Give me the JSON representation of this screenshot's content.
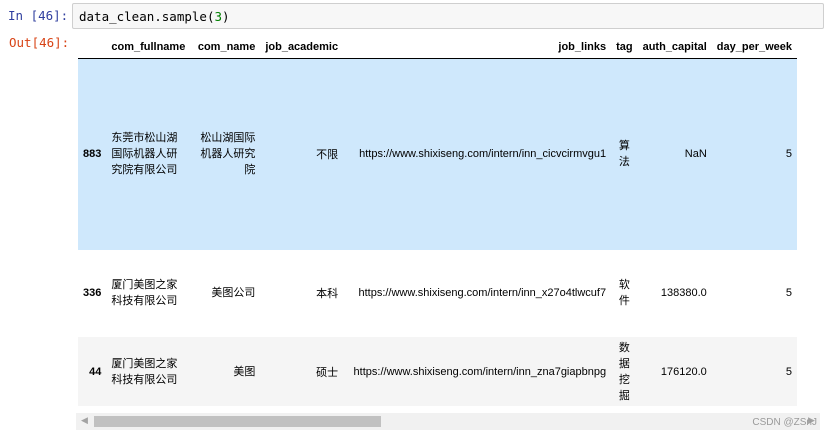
{
  "input_prompt": "In  [46]:",
  "output_prompt": "Out[46]:",
  "code": {
    "object": "data_clean.sample",
    "open_paren": "(",
    "arg": "3",
    "close_paren": ")"
  },
  "table": {
    "columns": [
      "",
      "com_fullname",
      "com_name",
      "job_academic",
      "job_links",
      "tag",
      "auth_capital",
      "day_per_week"
    ],
    "rows": [
      {
        "index": "883",
        "com_fullname": "东莞市松山湖国际机器人研究院有限公司",
        "com_name": "松山湖国际机器人研究院",
        "job_academic": "不限",
        "job_links": "https://www.shixiseng.com/intern/inn_cicvcirmvgu1",
        "tag": "算法",
        "auth_capital": "NaN",
        "day_per_week": "5"
      },
      {
        "index": "336",
        "com_fullname": "厦门美图之家科技有限公司",
        "com_name": "美图公司",
        "job_academic": "本科",
        "job_links": "https://www.shixiseng.com/intern/inn_x27o4tlwcuf7",
        "tag": "软件",
        "auth_capital": "138380.0",
        "day_per_week": "5"
      },
      {
        "index": "44",
        "com_fullname": "厦门美图之家科技有限公司",
        "com_name": "美图",
        "job_academic": "硕士",
        "job_links": "https://www.shixiseng.com/intern/inn_zna7giapbnpg",
        "tag": "数据挖掘",
        "auth_capital": "176120.0",
        "day_per_week": "5"
      }
    ]
  },
  "scrollbar": {
    "left_arrow": "◀",
    "right_arrow": "▶"
  },
  "watermark": "CSDN @ZSnJ"
}
